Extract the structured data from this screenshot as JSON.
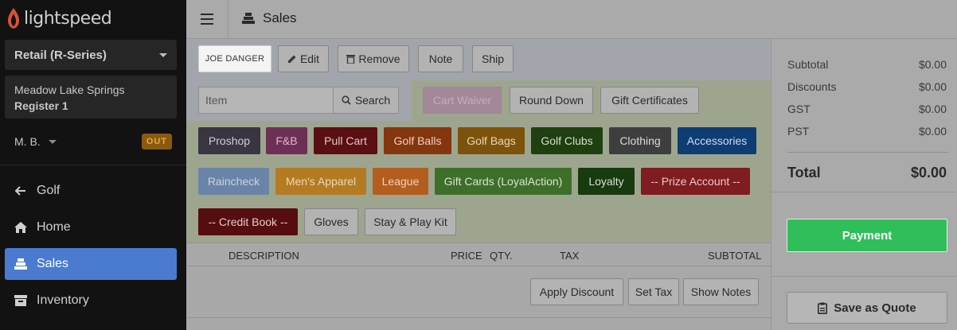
{
  "brand": {
    "logo_text": "lightspeed",
    "logo_color": "#d9533b"
  },
  "sidebar": {
    "account_select": "Retail (R-Series)",
    "location": "Meadow Lake Springs",
    "register": "Register 1",
    "user": "M. B.",
    "status_badge": "OUT",
    "nav": [
      {
        "label": "Golf",
        "icon": "arrow-left-icon"
      },
      {
        "label": "Home",
        "icon": "home-icon"
      },
      {
        "label": "Sales",
        "icon": "register-icon",
        "active": true
      },
      {
        "label": "Inventory",
        "icon": "box-icon"
      }
    ]
  },
  "topbar": {
    "title": "Sales"
  },
  "actions": {
    "customer": "JOE DANGER",
    "edit": "Edit",
    "remove": "Remove",
    "note": "Note",
    "ship": "Ship"
  },
  "search": {
    "placeholder": "Item",
    "button": "Search"
  },
  "quick_buttons": {
    "cart_waiver": "Cart Waiver",
    "round_down": "Round Down",
    "gift_certificates": "Gift Certificates",
    "proshop": "Proshop",
    "fb": "F&B",
    "pull_cart": "Pull Cart",
    "golf_balls": "Golf Balls",
    "golf_bags": "Golf Bags",
    "golf_clubs": "Golf Clubs",
    "clothing": "Clothing",
    "accessories": "Accessories",
    "raincheck": "Raincheck",
    "mens_apparel": "Men's Apparel",
    "league": "League",
    "gift_cards": "Gift Cards (LoyalAction)",
    "loyalty": "Loyalty",
    "prize_account": "-- Prize Account --",
    "credit_book": "-- Credit Book --",
    "gloves": "Gloves",
    "stay_play": "Stay & Play Kit"
  },
  "table": {
    "headers": {
      "description": "DESCRIPTION",
      "price": "PRICE",
      "qty": "QTY.",
      "tax": "TAX",
      "subtotal": "SUBTOTAL"
    }
  },
  "footer_buttons": {
    "apply_discount": "Apply Discount",
    "set_tax": "Set Tax",
    "show_notes": "Show Notes"
  },
  "summary": {
    "rows": [
      {
        "label": "Subtotal",
        "value": "$0.00"
      },
      {
        "label": "Discounts",
        "value": "$0.00"
      },
      {
        "label": "GST",
        "value": "$0.00"
      },
      {
        "label": "PST",
        "value": "$0.00"
      }
    ],
    "total_label": "Total",
    "total_value": "$0.00",
    "payment": "Payment",
    "save_quote": "Save as Quote"
  }
}
